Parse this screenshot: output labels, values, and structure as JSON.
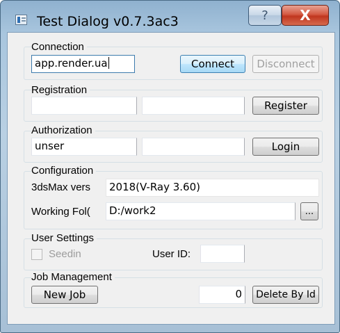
{
  "window": {
    "title": "Test Dialog v0.7.3ac3",
    "help_label": "?",
    "close_label": "X"
  },
  "connection": {
    "group_label": "Connection",
    "server_value": "app.render.ua",
    "connect_label": "Connect",
    "disconnect_label": "Disconnect"
  },
  "registration": {
    "group_label": "Registration",
    "field1_value": "",
    "field2_value": "",
    "register_label": "Register"
  },
  "authorization": {
    "group_label": "Authorization",
    "user_value": "unser",
    "password_value": "",
    "login_label": "Login"
  },
  "configuration": {
    "group_label": "Configuration",
    "max_version_label": "3dsMax vers",
    "max_version_value": "2018(V-Ray 3.60)",
    "working_folder_label": "Working Fol(",
    "working_folder_value": "D:/work2",
    "browse_label": "..."
  },
  "user_settings": {
    "group_label": "User Settings",
    "seeding_label": "Seedin",
    "seeding_checked": false,
    "user_id_label": "User ID:",
    "user_id_value": ""
  },
  "job_management": {
    "group_label": "Job Management",
    "new_job_label": "New Job",
    "job_id_value": "0",
    "delete_by_id_label": "Delete By Id"
  }
}
